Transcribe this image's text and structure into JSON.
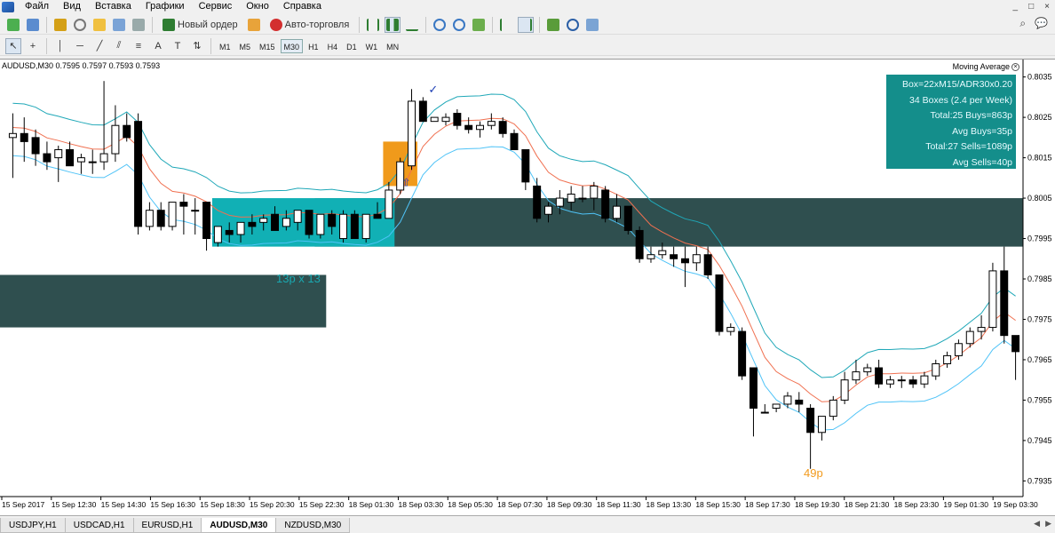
{
  "menu": {
    "items": [
      "Файл",
      "Вид",
      "Вставка",
      "Графики",
      "Сервис",
      "Окно",
      "Справка"
    ],
    "window_controls": [
      "_",
      "□",
      "×"
    ]
  },
  "toolbar": {
    "new_order_label": "Новый ордер",
    "autotrading_label": "Авто-торговля"
  },
  "timeframes": [
    "M1",
    "M5",
    "M15",
    "M30",
    "H1",
    "H4",
    "D1",
    "W1",
    "MN"
  ],
  "active_timeframe": "M30",
  "chart": {
    "header": "AUDUSD,M30  0.7595 0.7597 0.7593 0.7593",
    "indicator_label": "Moving Average",
    "info_panel": [
      "Box=22xM15/ADR30x0.20",
      "34 Boxes (2.4 per Week)",
      "Total:25 Buys=863p",
      "Avg Buys=35p",
      "Total:27 Sells=1089p",
      "Avg Sells=40p"
    ],
    "box_label": "13p x 13",
    "pips_label": "49p",
    "colors": {
      "background": "#ffffff",
      "dark_box": "#2f4f4f",
      "teal_box": "#11b0b5",
      "orange_box": "#f09a1b",
      "upper_band": "#20a8b8",
      "mid_band": "#f07050",
      "lower_band": "#4fc3f7",
      "info_panel": "#148e8b"
    }
  },
  "chart_data": {
    "type": "candlestick",
    "symbol": "AUDUSD",
    "timeframe": "M30",
    "y_ticks": [
      "0.8035",
      "0.8025",
      "0.8015",
      "0.8005",
      "0.7995",
      "0.7985",
      "0.7975",
      "0.7965",
      "0.7955",
      "0.7945",
      "0.7935"
    ],
    "ylim": [
      0.7932,
      0.8038
    ],
    "x_ticks": [
      "15 Sep 2017",
      "15 Sep 12:30",
      "15 Sep 14:30",
      "15 Sep 16:30",
      "15 Sep 18:30",
      "15 Sep 20:30",
      "15 Sep 22:30",
      "18 Sep 01:30",
      "18 Sep 03:30",
      "18 Sep 05:30",
      "18 Sep 07:30",
      "18 Sep 09:30",
      "18 Sep 11:30",
      "18 Sep 13:30",
      "18 Sep 15:30",
      "18 Sep 17:30",
      "18 Sep 19:30",
      "18 Sep 21:30",
      "18 Sep 23:30",
      "19 Sep 01:30",
      "19 Sep 03:30"
    ],
    "candles": [
      {
        "o": 0.802,
        "h": 0.8026,
        "l": 0.801,
        "c": 0.8021
      },
      {
        "o": 0.8021,
        "h": 0.8025,
        "l": 0.8014,
        "c": 0.8019
      },
      {
        "o": 0.802,
        "h": 0.8022,
        "l": 0.8013,
        "c": 0.8016
      },
      {
        "o": 0.8016,
        "h": 0.8019,
        "l": 0.8012,
        "c": 0.8014
      },
      {
        "o": 0.8015,
        "h": 0.8018,
        "l": 0.8009,
        "c": 0.8017
      },
      {
        "o": 0.8017,
        "h": 0.8019,
        "l": 0.8013,
        "c": 0.8013
      },
      {
        "o": 0.8014,
        "h": 0.8016,
        "l": 0.8011,
        "c": 0.8015
      },
      {
        "o": 0.8014,
        "h": 0.8017,
        "l": 0.8011,
        "c": 0.8014
      },
      {
        "o": 0.8014,
        "h": 0.8034,
        "l": 0.8012,
        "c": 0.8016
      },
      {
        "o": 0.8016,
        "h": 0.8028,
        "l": 0.8014,
        "c": 0.8023
      },
      {
        "o": 0.8023,
        "h": 0.8026,
        "l": 0.8019,
        "c": 0.802
      },
      {
        "o": 0.8024,
        "h": 0.8026,
        "l": 0.7996,
        "c": 0.7998
      },
      {
        "o": 0.7998,
        "h": 0.8004,
        "l": 0.7997,
        "c": 0.8002
      },
      {
        "o": 0.8002,
        "h": 0.8004,
        "l": 0.7997,
        "c": 0.7998
      },
      {
        "o": 0.7998,
        "h": 0.8004,
        "l": 0.7997,
        "c": 0.8004
      },
      {
        "o": 0.8004,
        "h": 0.8006,
        "l": 0.7996,
        "c": 0.8003
      },
      {
        "o": 0.8002,
        "h": 0.8005,
        "l": 0.7996,
        "c": 0.8002
      },
      {
        "o": 0.8004,
        "h": 0.8004,
        "l": 0.7992,
        "c": 0.7995
      },
      {
        "o": 0.7994,
        "h": 0.7998,
        "l": 0.7993,
        "c": 0.7998
      },
      {
        "o": 0.7997,
        "h": 0.7999,
        "l": 0.7994,
        "c": 0.7996
      },
      {
        "o": 0.7996,
        "h": 0.7999,
        "l": 0.7994,
        "c": 0.7999
      },
      {
        "o": 0.7999,
        "h": 0.8001,
        "l": 0.7996,
        "c": 0.7998
      },
      {
        "o": 0.7999,
        "h": 0.8001,
        "l": 0.7997,
        "c": 0.8
      },
      {
        "o": 0.8001,
        "h": 0.8003,
        "l": 0.7997,
        "c": 0.7997
      },
      {
        "o": 0.7998,
        "h": 0.8002,
        "l": 0.7997,
        "c": 0.8
      },
      {
        "o": 0.7999,
        "h": 0.8002,
        "l": 0.7997,
        "c": 0.8002
      },
      {
        "o": 0.8002,
        "h": 0.8002,
        "l": 0.7995,
        "c": 0.7996
      },
      {
        "o": 0.7996,
        "h": 0.8001,
        "l": 0.7995,
        "c": 0.8001
      },
      {
        "o": 0.8001,
        "h": 0.8002,
        "l": 0.7996,
        "c": 0.7998
      },
      {
        "o": 0.7995,
        "h": 0.8002,
        "l": 0.7994,
        "c": 0.8001
      },
      {
        "o": 0.8001,
        "h": 0.8002,
        "l": 0.7995,
        "c": 0.7995
      },
      {
        "o": 0.7995,
        "h": 0.8001,
        "l": 0.7994,
        "c": 0.8001
      },
      {
        "o": 0.8001,
        "h": 0.8004,
        "l": 0.8,
        "c": 0.8
      },
      {
        "o": 0.8,
        "h": 0.8009,
        "l": 0.8,
        "c": 0.8007
      },
      {
        "o": 0.8007,
        "h": 0.8015,
        "l": 0.8006,
        "c": 0.8014
      },
      {
        "o": 0.8013,
        "h": 0.8032,
        "l": 0.8012,
        "c": 0.8029
      },
      {
        "o": 0.8029,
        "h": 0.803,
        "l": 0.8024,
        "c": 0.8024
      },
      {
        "o": 0.8024,
        "h": 0.8025,
        "l": 0.8024,
        "c": 0.8025
      },
      {
        "o": 0.8024,
        "h": 0.8026,
        "l": 0.8023,
        "c": 0.8025
      },
      {
        "o": 0.8026,
        "h": 0.8027,
        "l": 0.8022,
        "c": 0.8023
      },
      {
        "o": 0.8023,
        "h": 0.8025,
        "l": 0.8021,
        "c": 0.8022
      },
      {
        "o": 0.8022,
        "h": 0.8024,
        "l": 0.802,
        "c": 0.8023
      },
      {
        "o": 0.8023,
        "h": 0.8026,
        "l": 0.8022,
        "c": 0.8024
      },
      {
        "o": 0.8024,
        "h": 0.8025,
        "l": 0.802,
        "c": 0.8021
      },
      {
        "o": 0.8021,
        "h": 0.8022,
        "l": 0.8017,
        "c": 0.8017
      },
      {
        "o": 0.8017,
        "h": 0.8017,
        "l": 0.8007,
        "c": 0.8009
      },
      {
        "o": 0.8008,
        "h": 0.801,
        "l": 0.7999,
        "c": 0.8
      },
      {
        "o": 0.8001,
        "h": 0.8004,
        "l": 0.7999,
        "c": 0.8003
      },
      {
        "o": 0.8003,
        "h": 0.8007,
        "l": 0.8001,
        "c": 0.8005
      },
      {
        "o": 0.8004,
        "h": 0.8008,
        "l": 0.8002,
        "c": 0.8006
      },
      {
        "o": 0.8005,
        "h": 0.8008,
        "l": 0.8004,
        "c": 0.8005
      },
      {
        "o": 0.8005,
        "h": 0.8009,
        "l": 0.8002,
        "c": 0.8008
      },
      {
        "o": 0.8007,
        "h": 0.8008,
        "l": 0.7999,
        "c": 0.8
      },
      {
        "o": 0.8,
        "h": 0.8006,
        "l": 0.7999,
        "c": 0.8003
      },
      {
        "o": 0.8003,
        "h": 0.8003,
        "l": 0.7996,
        "c": 0.7997
      },
      {
        "o": 0.7997,
        "h": 0.7998,
        "l": 0.7989,
        "c": 0.799
      },
      {
        "o": 0.799,
        "h": 0.7993,
        "l": 0.7989,
        "c": 0.7991
      },
      {
        "o": 0.7991,
        "h": 0.7994,
        "l": 0.799,
        "c": 0.7992
      },
      {
        "o": 0.7991,
        "h": 0.7993,
        "l": 0.7988,
        "c": 0.799
      },
      {
        "o": 0.799,
        "h": 0.7993,
        "l": 0.7983,
        "c": 0.7989
      },
      {
        "o": 0.7989,
        "h": 0.7993,
        "l": 0.7987,
        "c": 0.7991
      },
      {
        "o": 0.7991,
        "h": 0.7993,
        "l": 0.7985,
        "c": 0.7986
      },
      {
        "o": 0.7986,
        "h": 0.7986,
        "l": 0.7971,
        "c": 0.7972
      },
      {
        "o": 0.7972,
        "h": 0.7974,
        "l": 0.7971,
        "c": 0.7973
      },
      {
        "o": 0.7972,
        "h": 0.7973,
        "l": 0.796,
        "c": 0.7961
      },
      {
        "o": 0.7963,
        "h": 0.7963,
        "l": 0.7946,
        "c": 0.7953
      },
      {
        "o": 0.7952,
        "h": 0.7954,
        "l": 0.7952,
        "c": 0.7952
      },
      {
        "o": 0.7953,
        "h": 0.7954,
        "l": 0.7952,
        "c": 0.7954
      },
      {
        "o": 0.7954,
        "h": 0.7957,
        "l": 0.7953,
        "c": 0.7956
      },
      {
        "o": 0.7955,
        "h": 0.7957,
        "l": 0.7952,
        "c": 0.7954
      },
      {
        "o": 0.7953,
        "h": 0.7954,
        "l": 0.7938,
        "c": 0.7947
      },
      {
        "o": 0.7947,
        "h": 0.795,
        "l": 0.7945,
        "c": 0.7951
      },
      {
        "o": 0.7951,
        "h": 0.7956,
        "l": 0.795,
        "c": 0.7955
      },
      {
        "o": 0.7955,
        "h": 0.7962,
        "l": 0.7954,
        "c": 0.796
      },
      {
        "o": 0.796,
        "h": 0.7965,
        "l": 0.7959,
        "c": 0.7962
      },
      {
        "o": 0.7962,
        "h": 0.7964,
        "l": 0.7961,
        "c": 0.7963
      },
      {
        "o": 0.7963,
        "h": 0.7965,
        "l": 0.7958,
        "c": 0.7959
      },
      {
        "o": 0.7959,
        "h": 0.7961,
        "l": 0.7958,
        "c": 0.796
      },
      {
        "o": 0.796,
        "h": 0.7961,
        "l": 0.7958,
        "c": 0.796
      },
      {
        "o": 0.796,
        "h": 0.7961,
        "l": 0.7958,
        "c": 0.7959
      },
      {
        "o": 0.7959,
        "h": 0.7962,
        "l": 0.7958,
        "c": 0.7961
      },
      {
        "o": 0.7961,
        "h": 0.7965,
        "l": 0.796,
        "c": 0.7964
      },
      {
        "o": 0.7964,
        "h": 0.7967,
        "l": 0.7963,
        "c": 0.7966
      },
      {
        "o": 0.7966,
        "h": 0.797,
        "l": 0.7965,
        "c": 0.7969
      },
      {
        "o": 0.7969,
        "h": 0.7973,
        "l": 0.7968,
        "c": 0.7972
      },
      {
        "o": 0.7972,
        "h": 0.7976,
        "l": 0.797,
        "c": 0.7973
      },
      {
        "o": 0.7973,
        "h": 0.7989,
        "l": 0.7972,
        "c": 0.7987
      },
      {
        "o": 0.7987,
        "h": 0.7993,
        "l": 0.7969,
        "c": 0.7971
      },
      {
        "o": 0.7971,
        "h": 0.7971,
        "l": 0.796,
        "c": 0.7967
      }
    ],
    "dark_box_upper": {
      "from_index": 27,
      "to_index": 89,
      "top": 0.8005,
      "bottom": 0.7993
    },
    "dark_box_left": {
      "from_index": 0,
      "to_index": 28,
      "top": 0.7986,
      "bottom": 0.7973
    },
    "teal_box": {
      "from_index": 18,
      "to_index": 34,
      "top": 0.8005,
      "bottom": 0.7993
    },
    "orange_box": {
      "from_index": 33,
      "to_index": 36,
      "top": 0.8019,
      "bottom": 0.8008
    }
  },
  "tabs": [
    "USDJPY,H1",
    "USDCAD,H1",
    "EURUSD,H1",
    "AUDUSD,M30",
    "NZDUSD,M30"
  ],
  "active_tab": "AUDUSD,M30"
}
